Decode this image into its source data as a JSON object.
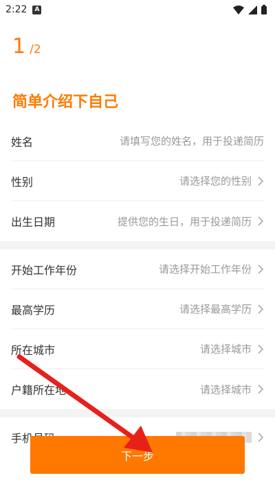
{
  "status_bar": {
    "time": "2:22",
    "notification_icon": "a-box-icon"
  },
  "step": {
    "current": "1",
    "total": "/2"
  },
  "heading": "简单介绍下自己",
  "group1": [
    {
      "label": "姓名",
      "value": "请填写您的姓名，用于投递简历",
      "chevron": false
    },
    {
      "label": "性别",
      "value": "请选择您的性别",
      "chevron": true
    },
    {
      "label": "出生日期",
      "value": "提供您的生日，用于投递简历",
      "chevron": true
    }
  ],
  "group2": [
    {
      "label": "开始工作年份",
      "value": "请选择开始工作年份",
      "chevron": true
    },
    {
      "label": "最高学历",
      "value": "请选择最高学历",
      "chevron": true
    },
    {
      "label": "所在城市",
      "value": "请选择城市",
      "chevron": true
    },
    {
      "label": "户籍所在地",
      "value": "请选择城市",
      "chevron": true
    }
  ],
  "phone": {
    "label": "手机号码"
  },
  "next_button": "下一步",
  "colors": {
    "accent": "#ff7a00",
    "arrow": "#e8201a"
  }
}
